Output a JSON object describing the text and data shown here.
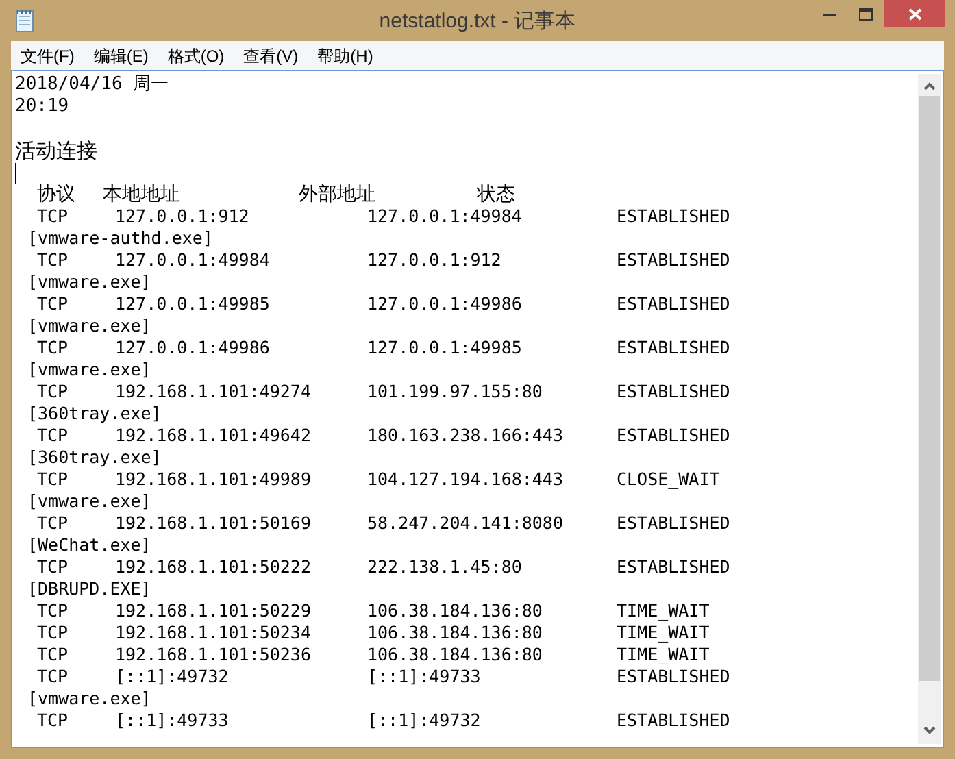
{
  "window": {
    "title": "netstatlog.txt - 记事本"
  },
  "menu": [
    {
      "label": "文件(F)"
    },
    {
      "label": "编辑(E)"
    },
    {
      "label": "格式(O)"
    },
    {
      "label": "查看(V)"
    },
    {
      "label": "帮助(H)"
    }
  ],
  "document": {
    "date": "2018/04/16 周一",
    "time": "20:19",
    "section_title": "活动连接",
    "header": [
      "协议",
      "本地地址",
      "外部地址",
      "状态"
    ],
    "entries": [
      {
        "protocol": "TCP",
        "local": "127.0.0.1:912",
        "foreign": "127.0.0.1:49984",
        "state": "ESTABLISHED",
        "process": "[vmware-authd.exe]"
      },
      {
        "protocol": "TCP",
        "local": "127.0.0.1:49984",
        "foreign": "127.0.0.1:912",
        "state": "ESTABLISHED",
        "process": "[vmware.exe]"
      },
      {
        "protocol": "TCP",
        "local": "127.0.0.1:49985",
        "foreign": "127.0.0.1:49986",
        "state": "ESTABLISHED",
        "process": "[vmware.exe]"
      },
      {
        "protocol": "TCP",
        "local": "127.0.0.1:49986",
        "foreign": "127.0.0.1:49985",
        "state": "ESTABLISHED",
        "process": "[vmware.exe]"
      },
      {
        "protocol": "TCP",
        "local": "192.168.1.101:49274",
        "foreign": "101.199.97.155:80",
        "state": "ESTABLISHED",
        "process": "[360tray.exe]"
      },
      {
        "protocol": "TCP",
        "local": "192.168.1.101:49642",
        "foreign": "180.163.238.166:443",
        "state": "ESTABLISHED",
        "process": "[360tray.exe]"
      },
      {
        "protocol": "TCP",
        "local": "192.168.1.101:49989",
        "foreign": "104.127.194.168:443",
        "state": "CLOSE_WAIT",
        "process": "[vmware.exe]"
      },
      {
        "protocol": "TCP",
        "local": "192.168.1.101:50169",
        "foreign": "58.247.204.141:8080",
        "state": "ESTABLISHED",
        "process": "[WeChat.exe]"
      },
      {
        "protocol": "TCP",
        "local": "192.168.1.101:50222",
        "foreign": "222.138.1.45:80",
        "state": "ESTABLISHED",
        "process": "[DBRUPD.EXE]"
      },
      {
        "protocol": "TCP",
        "local": "192.168.1.101:50229",
        "foreign": "106.38.184.136:80",
        "state": "TIME_WAIT"
      },
      {
        "protocol": "TCP",
        "local": "192.168.1.101:50234",
        "foreign": "106.38.184.136:80",
        "state": "TIME_WAIT"
      },
      {
        "protocol": "TCP",
        "local": "192.168.1.101:50236",
        "foreign": "106.38.184.136:80",
        "state": "TIME_WAIT"
      },
      {
        "protocol": "TCP",
        "local": "[::1]:49732",
        "foreign": "[::1]:49733",
        "state": "ESTABLISHED",
        "process": "[vmware.exe]"
      },
      {
        "protocol": "TCP",
        "local": "[::1]:49733",
        "foreign": "[::1]:49732",
        "state": "ESTABLISHED"
      }
    ]
  }
}
